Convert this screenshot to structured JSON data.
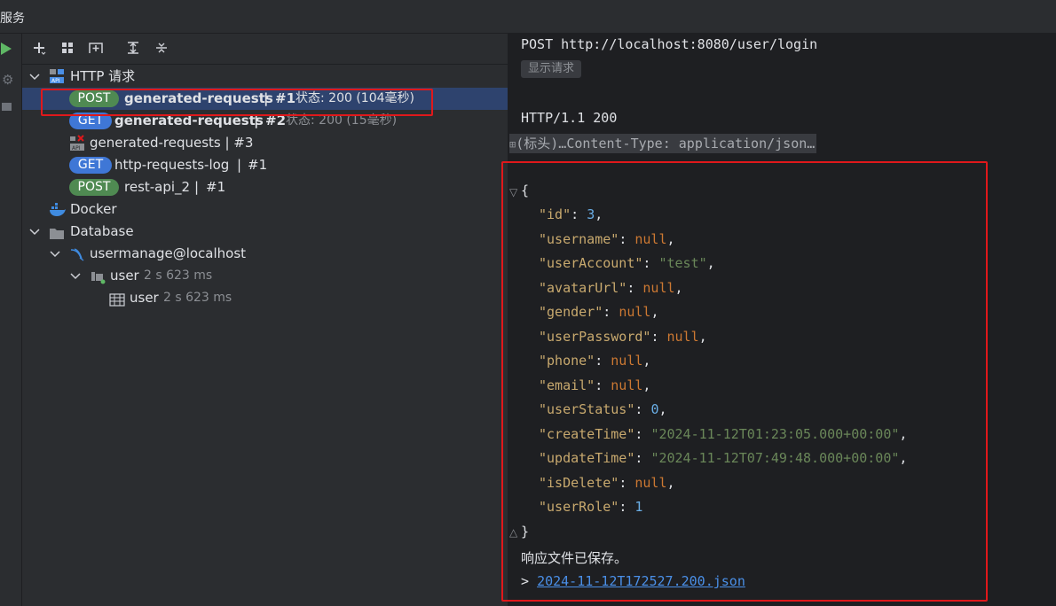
{
  "window": {
    "title": "服务"
  },
  "toolbar": {
    "buttons": [
      "add-icon",
      "group-icon",
      "new-tab-icon",
      "expand-all-icon",
      "collapse-all-icon"
    ]
  },
  "tree": {
    "http_group": "HTTP 请求",
    "requests": [
      {
        "method": "POST",
        "name": "generated-requests",
        "sep": "|",
        "num": "#1",
        "status": "状态: 200 (104毫秒)",
        "selected": true
      },
      {
        "method": "GET",
        "name": "generated-requests",
        "sep": "|",
        "num": "#2",
        "status": "状态: 200 (15毫秒)"
      },
      {
        "method": "",
        "name": "generated-requests | #3"
      },
      {
        "method": "GET",
        "name": "http-requests-log",
        "sep": "|",
        "num": "#1"
      },
      {
        "method": "POST",
        "name": "rest-api_2",
        "sep": "|",
        "num": "#1"
      }
    ],
    "docker": "Docker",
    "database": "Database",
    "datasource": "usermanage@localhost",
    "schema": {
      "name": "user",
      "time": "2 s 623 ms"
    },
    "table": {
      "name": "user",
      "time": "2 s 623 ms"
    }
  },
  "response": {
    "request_line": "POST http://localhost:8080/user/login",
    "show_request": "显示请求",
    "status_line": "HTTP/1.1 200",
    "headers_collapsed": "(标头)…Content-Type: application/json…",
    "json_open": "{",
    "json_close": "}",
    "fields": [
      {
        "key": "\"id\"",
        "value": "3",
        "kind": "num"
      },
      {
        "key": "\"username\"",
        "value": "null",
        "kind": "null"
      },
      {
        "key": "\"userAccount\"",
        "value": "\"test\"",
        "kind": "str"
      },
      {
        "key": "\"avatarUrl\"",
        "value": "null",
        "kind": "null"
      },
      {
        "key": "\"gender\"",
        "value": "null",
        "kind": "null"
      },
      {
        "key": "\"userPassword\"",
        "value": "null",
        "kind": "null"
      },
      {
        "key": "\"phone\"",
        "value": "null",
        "kind": "null"
      },
      {
        "key": "\"email\"",
        "value": "null",
        "kind": "null"
      },
      {
        "key": "\"userStatus\"",
        "value": "0",
        "kind": "num"
      },
      {
        "key": "\"createTime\"",
        "value": "\"2024-11-12T01:23:05.000+00:00\"",
        "kind": "str"
      },
      {
        "key": "\"updateTime\"",
        "value": "\"2024-11-12T07:49:48.000+00:00\"",
        "kind": "str"
      },
      {
        "key": "\"isDelete\"",
        "value": "null",
        "kind": "null"
      },
      {
        "key": "\"userRole\"",
        "value": "1",
        "kind": "num"
      }
    ],
    "saved_text": "响应文件已保存。",
    "file_prefix": ">",
    "file_name": "2024-11-12T172527.200.json"
  },
  "colors": {
    "highlight": "#e0181b",
    "selected_row": "#2e436e",
    "post": "#4f8a52",
    "get": "#3f77d6"
  }
}
